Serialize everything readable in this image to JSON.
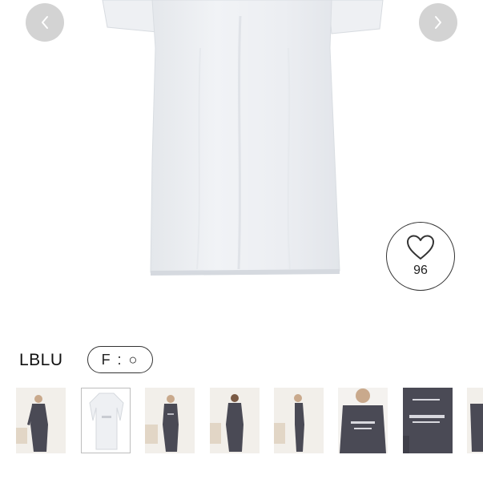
{
  "gallery": {
    "prev_icon": "chevron-left-icon",
    "next_icon": "chevron-right-icon",
    "favorite": {
      "icon": "heart-icon",
      "count": "96"
    }
  },
  "product": {
    "color_label": "LBLU",
    "size_option": "F : ○"
  },
  "thumbnails": [
    {
      "name": "thumb-model-dark-front",
      "style": "model-dark"
    },
    {
      "name": "thumb-white-flat",
      "style": "flat-white",
      "selected": true
    },
    {
      "name": "thumb-model-dark-front-2",
      "style": "model-dark"
    },
    {
      "name": "thumb-model-dark-back",
      "style": "model-dark"
    },
    {
      "name": "thumb-model-dark-side",
      "style": "model-dark"
    },
    {
      "name": "thumb-print-closeup",
      "style": "closeup-dark"
    },
    {
      "name": "thumb-print-closeup-2",
      "style": "closeup-dark"
    },
    {
      "name": "thumb-partial",
      "style": "model-dark"
    }
  ],
  "colors": {
    "nav_button": "#d3d3d3",
    "dress_fill": "#eceef1",
    "dark_garment": "#4a4a55",
    "thumb_background": "#f2efea"
  }
}
